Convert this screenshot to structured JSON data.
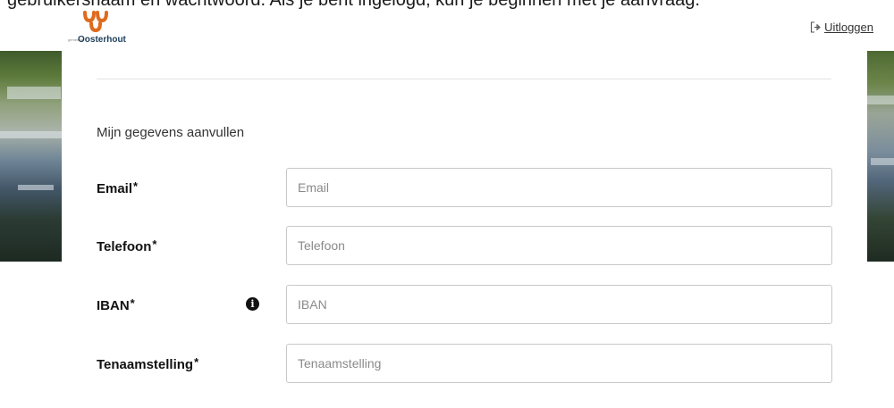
{
  "intro": {
    "text": "gebruikersnaam en wachtwoord. Als je bent ingelogd, kun je beginnen met je aanvraag."
  },
  "logo": {
    "small_text": "gemeente",
    "name": "Oosterhout",
    "color": "#e06a1b"
  },
  "header": {
    "logout_icon": "logout-icon",
    "logout_label": "Uitloggen"
  },
  "form": {
    "section_title": "Mijn gegevens aanvullen",
    "fields": [
      {
        "label": "Email",
        "required": "*",
        "placeholder": "Email",
        "value": ""
      },
      {
        "label": "Telefoon",
        "required": "*",
        "placeholder": "Telefoon",
        "value": ""
      },
      {
        "label": "IBAN",
        "required": "*",
        "placeholder": "IBAN",
        "value": "",
        "info_icon": "info-icon"
      },
      {
        "label": "Tenaamstelling",
        "required": "*",
        "placeholder": "Tenaamstelling",
        "value": ""
      }
    ]
  }
}
